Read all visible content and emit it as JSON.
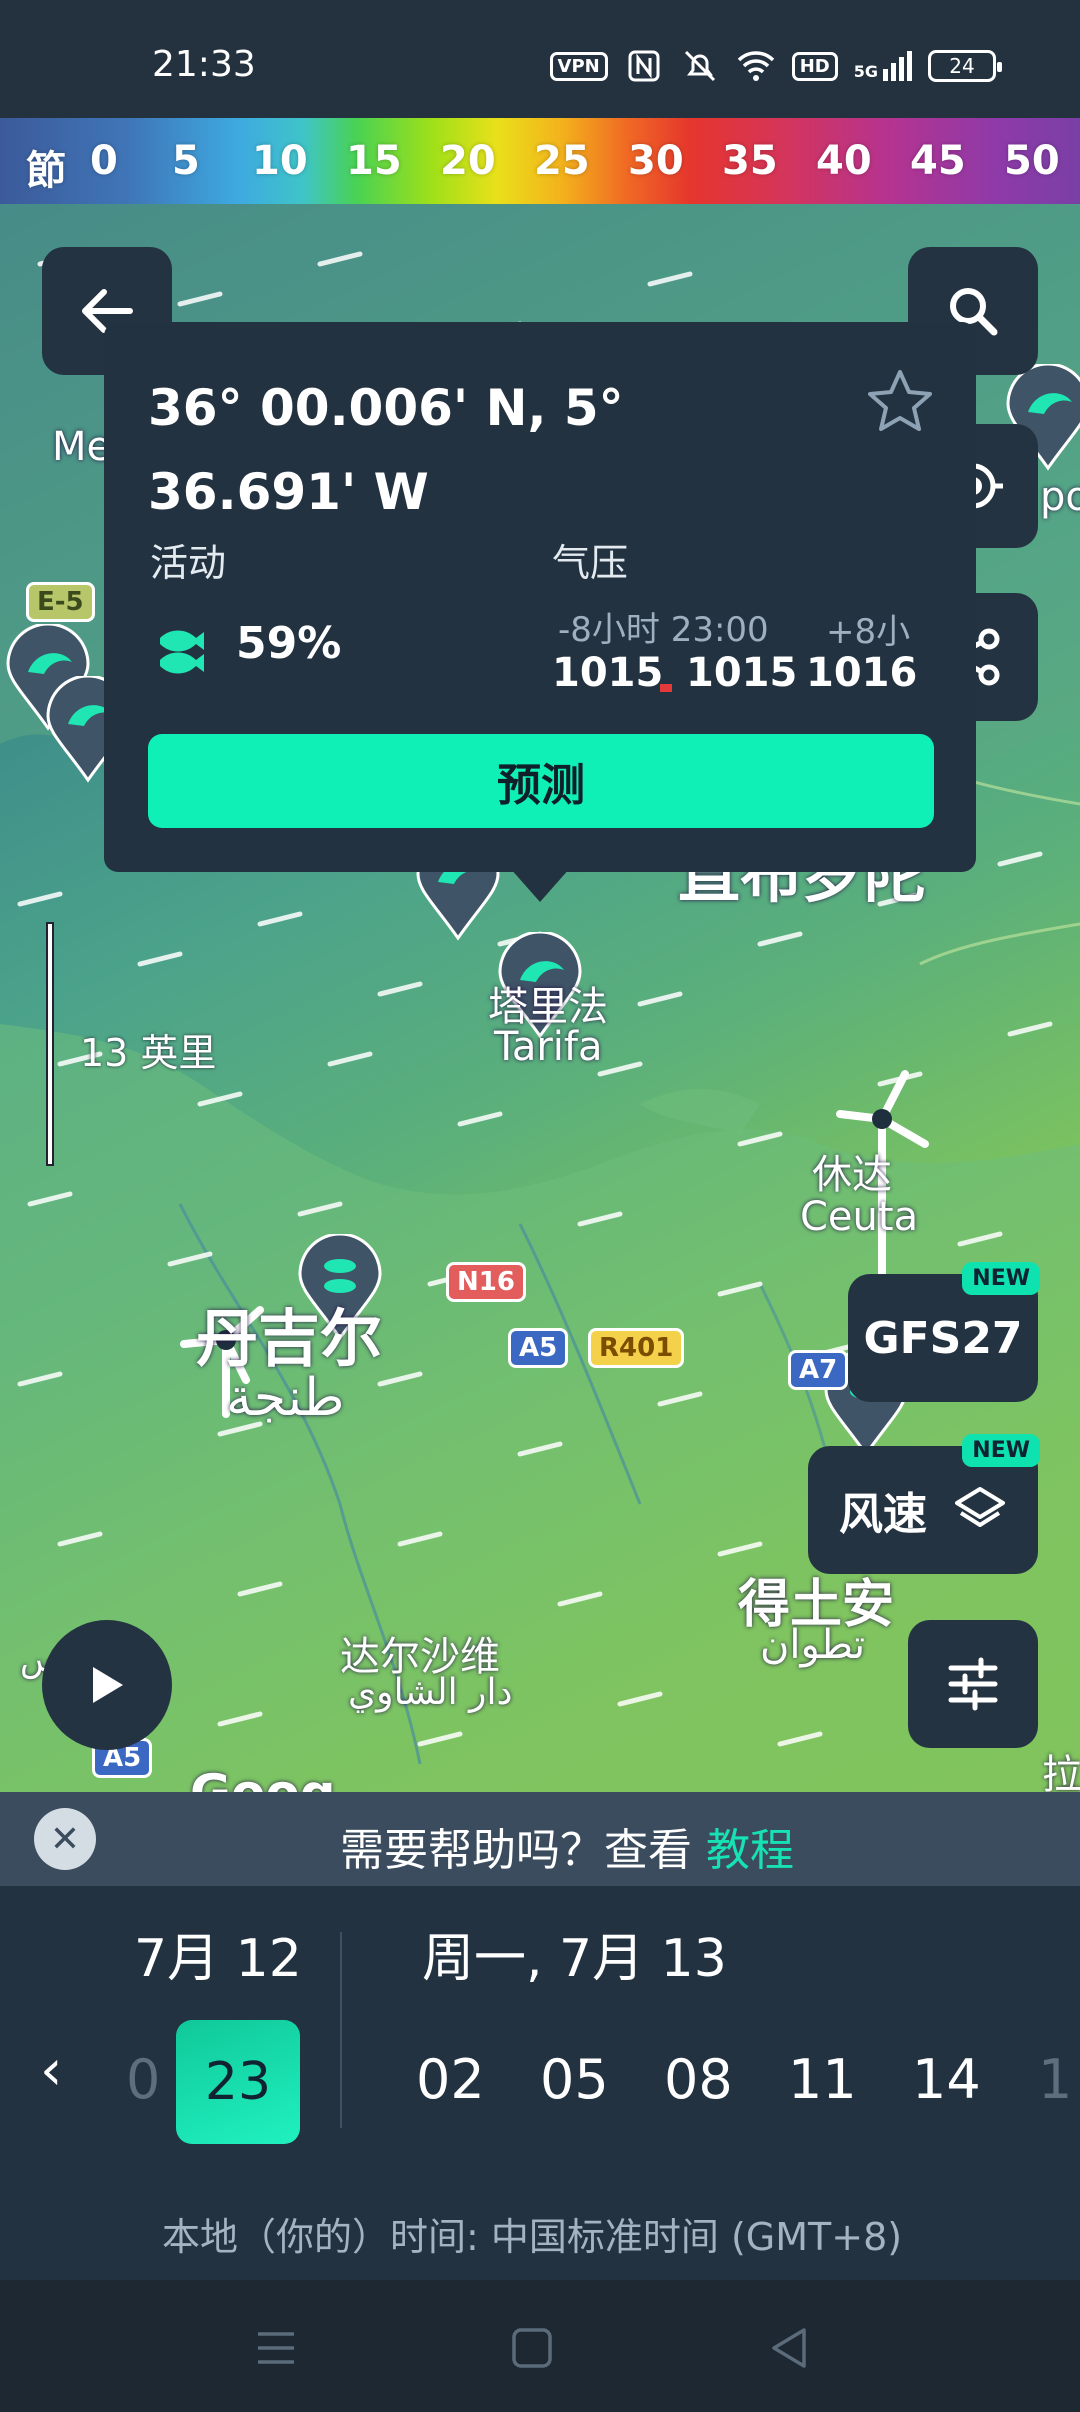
{
  "status_bar": {
    "time": "21:33",
    "vpn": "VPN",
    "hd": "HD",
    "signal": "5G",
    "battery": "24"
  },
  "legend": {
    "unit": "節",
    "ticks": [
      "0",
      "5",
      "10",
      "15",
      "20",
      "25",
      "30",
      "35",
      "40",
      "45",
      "50"
    ]
  },
  "map": {
    "labels": {
      "tarifa_cn": "塔里法",
      "tarifa": "Tarifa",
      "ceuta_cn": "休达",
      "ceuta": "Ceuta",
      "tangier_cn": "丹吉尔",
      "tangier_ar": "طنجة",
      "tetouan_cn": "得土安",
      "tetouan_ar": "تطوان",
      "dar_cn": "达尔沙维",
      "dar_ar": "دار الشاوي",
      "gib_cn": "直布罗陀",
      "me": "Me",
      "po": "po",
      "la": "拉",
      "ar_left": "أقواس",
      "google": "Goog"
    },
    "roads": {
      "e5": "E-5",
      "n16": "N16",
      "a5": "A5",
      "r401": "R401",
      "a7": "A7",
      "a5b": "A5"
    },
    "scale": "13 英里"
  },
  "popup": {
    "coords": "36° 00.006' N, 5° 36.691' W",
    "activity_label": "活动",
    "activity_value": "59%",
    "pressure_label": "气压",
    "pressure_headers": [
      "-8小时 23:00",
      "+8小"
    ],
    "pressure_values": [
      "1015",
      "1015",
      "1016"
    ],
    "forecast": "预测"
  },
  "controls": {
    "model": "GFS27",
    "new_badge": "NEW",
    "layer": "风速"
  },
  "help": {
    "text": "需要帮助吗？查看",
    "link": "教程"
  },
  "timeline": {
    "prev_day": "7月 12",
    "current_day": "周一, 7月 13",
    "hours": [
      "0",
      "23",
      "02",
      "05",
      "08",
      "11",
      "14",
      "1"
    ],
    "timezone": "本地（你的）时间: 中国标准时间 (GMT+8)"
  },
  "colors": {
    "accent": "#0ff0b7",
    "panel": "#233240",
    "help_link": "#17e2b4"
  }
}
